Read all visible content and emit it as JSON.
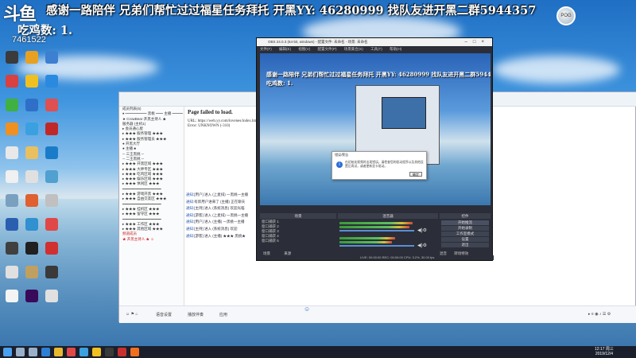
{
  "overlay": {
    "logo": "斗鱼",
    "banner": "感谢一路陪伴  兄弟们帮忙过过福星任务拜托  开黑YY: 46280999  找队友进开黑二群5944357",
    "room_id": "7461522",
    "chicken_count": "吃鸡数: 1."
  },
  "desktop_icons": [
    {
      "label": "",
      "color": "#3b3b3b"
    },
    {
      "label": "",
      "color": "#e8a020"
    },
    {
      "label": "",
      "color": "#3d7fd0"
    },
    {
      "label": "",
      "color": "#d94040"
    },
    {
      "label": "",
      "color": "#f0c020"
    },
    {
      "label": "",
      "color": "#2a8ae0"
    },
    {
      "label": "",
      "color": "#40b040"
    },
    {
      "label": "",
      "color": "#2f6fc8"
    },
    {
      "label": "",
      "color": "#e05050"
    },
    {
      "label": "",
      "color": "#f09020"
    },
    {
      "label": "",
      "color": "#3aa0e0"
    },
    {
      "label": "",
      "color": "#c02828"
    },
    {
      "label": "",
      "color": "#e8e8e8"
    },
    {
      "label": "",
      "color": "#e8c060"
    },
    {
      "label": "",
      "color": "#1a7cc8"
    },
    {
      "label": "",
      "color": "#f0f0f0"
    },
    {
      "label": "",
      "color": "#e0e0e0"
    },
    {
      "label": "",
      "color": "#50a0d0"
    },
    {
      "label": "",
      "color": "#7aa0c0"
    },
    {
      "label": "",
      "color": "#e06030"
    },
    {
      "label": "",
      "color": "#c0c0c0"
    },
    {
      "label": "",
      "color": "#2a5fb0"
    },
    {
      "label": "",
      "color": "#3090d0"
    },
    {
      "label": "",
      "color": "#e04848"
    },
    {
      "label": "",
      "color": "#404040"
    },
    {
      "label": "",
      "color": "#202020"
    },
    {
      "label": "",
      "color": "#d03030"
    },
    {
      "label": "",
      "color": "#e0e0e0"
    },
    {
      "label": "",
      "color": "#c0a060"
    },
    {
      "label": "",
      "color": "#3a3a3a"
    },
    {
      "label": "",
      "color": "#f4f4f4"
    },
    {
      "label": "",
      "color": "#3a0a5a"
    },
    {
      "label": "",
      "color": "#e0e0e0"
    }
  ],
  "chat_window": {
    "title": "",
    "page_failed": "Page failed to load.",
    "url_line": "URL: https://web.yy.com/lovenes/index.html",
    "error_line": "Error: UNKNOWN (-310)",
    "tree": [
      {
        "text": "成员列表(5)",
        "red": false
      },
      {
        "text": "♦ ━━━━━━ 黑桃 ━━ 主播 ━━━",
        "red": false
      },
      {
        "text": "  ★ CrowBear·开黑主持人 ★",
        "red": false
      },
      {
        "text": "服务器 (主机1)",
        "red": false
      },
      {
        "text": "  ▸ 会员通心屋",
        "red": false
      },
      {
        "text": "  ▸ ★★★ 服务管理 ★★★",
        "red": false
      },
      {
        "text": "  ▸ ★★★ 服务管理员 ★★★",
        "red": false
      },
      {
        "text": "     ● 开黑大厅",
        "red": false
      },
      {
        "text": "     ● 主播 ♣",
        "red": false
      },
      {
        "text": "     ─ 三王黑桃 ─",
        "red": false
      },
      {
        "text": "     ─ 二王黑桃 ─",
        "red": false
      },
      {
        "text": "▸ ★★★ 开黑区域 ★★★",
        "red": false
      },
      {
        "text": "▸ ★★★ 大神专区 ★★★",
        "red": false
      },
      {
        "text": "▸ ★★★ 吃鸡区域 ★★★",
        "red": false
      },
      {
        "text": "▸ ★★★ 娱乐区域 ★★★",
        "red": false
      },
      {
        "text": "▸ ★★★ 休闲区 ★★★",
        "red": false
      },
      {
        "text": "━━━━━━━━━━━━━━━━━━",
        "red": false
      },
      {
        "text": "▸ ★★★ 游戏开黑 ★★★",
        "red": false
      },
      {
        "text": "▸ ★★★ 自由交友区 ★★★",
        "red": false
      },
      {
        "text": "━━━━━━━━━━━━━━━━━━",
        "red": false
      },
      {
        "text": "▸ ★★★ 挂机区 ★★★",
        "red": false
      },
      {
        "text": "▸ ★★★ 留守区 ★★★",
        "red": false
      },
      {
        "text": "━━━━━━━━━━━━━━━━━━",
        "red": false
      },
      {
        "text": "▸ ★★★ 工作区 ★★★",
        "red": false
      },
      {
        "text": "▸ ★★★ 其他区域 ★★★",
        "red": false
      },
      {
        "text": "频道成员",
        "red": true
      },
      {
        "text": "  ★ 开黑主持人 ★ ☺",
        "red": true
      }
    ],
    "messages": [
      {
        "who": "通知:",
        "text": "[用户] 进入 (上麦排) 一黑桃一主播"
      },
      {
        "who": "通知:",
        "text": "有新用户进来了 (主播) 正在聊天"
      },
      {
        "who": "通知:",
        "text": "[主持] 进入 (系统消息) 欢迎光临"
      },
      {
        "who": "通知:",
        "text": "[游客] 进入 (上麦排) 一黑桃一主播"
      },
      {
        "who": "通知:",
        "text": "[用户] 进入 (主播) 一黑桃一主播"
      },
      {
        "who": "通知:",
        "text": "[主持] 进入 (系统消息) 欢迎"
      },
      {
        "who": "通知:",
        "text": "[游客] 进入 (主播) ★★★ 黑桃★"
      }
    ],
    "bottom_items": [
      "语音设置",
      "播放伴奏",
      "应用"
    ],
    "bottom_right": "▸ ≡ ◉ ♪ ☰ ⚙"
  },
  "obs": {
    "title": "OBS 24.0.3 (64-bit, windows) - 配置文件: 未命名 - 场景: 未命名",
    "menu": "文件(F) 编辑(E) 视图(V) 配置文件(P) 场景集合(S) 工具(T) 帮助(H)",
    "preview_banner": "感谢一路陪伴  兄弟们帮忙过过福星任务拜托  开黑YY: 46280999  找队友进开黑二群5944357",
    "preview_chicken": "吃鸡数: 1.",
    "dialog_title": "错误/警告",
    "dialog_message": "在初始化视频时出现错误。请检查您的驱动程序以及其他设置后再试，或者更新显卡驱动。",
    "dialog_ok": "确定",
    "docks": {
      "scenes": "场景",
      "mixer": "混音器",
      "controls": "控件"
    },
    "sources": [
      "窗口捕获 1",
      "窗口捕获 2",
      "窗口捕获 3",
      "窗口捕获 4",
      "窗口捕获 5"
    ],
    "scene_btns": [
      "场景",
      "来源"
    ],
    "controls": [
      "开始推流",
      "开始录制",
      "工作室模式",
      "设置",
      "退出"
    ],
    "bottom_tabs": [
      "混音",
      "转场特效"
    ],
    "status": "LIVE: 00:00:00   REC: 00:00:00   CPU: 3.2%, 30.00 fps"
  },
  "taskbar": {
    "time": "12:17 周三",
    "date": "2019/12/4",
    "icons": [
      {
        "name": "start-icon",
        "color": "#4aa0f0"
      },
      {
        "name": "search-icon",
        "color": "#9ab0c8"
      },
      {
        "name": "task-view-icon",
        "color": "#9ab0c8"
      },
      {
        "name": "edge-icon",
        "color": "#2d7fd6"
      },
      {
        "name": "explorer-icon",
        "color": "#e8b830"
      },
      {
        "name": "chrome-icon",
        "color": "#e04848"
      },
      {
        "name": "qq-icon",
        "color": "#3aa0e0"
      },
      {
        "name": "yy-icon",
        "color": "#f0c020"
      },
      {
        "name": "obs-icon",
        "color": "#3a3a3a"
      },
      {
        "name": "game-icon",
        "color": "#c83030"
      },
      {
        "name": "douyu-icon",
        "color": "#f07020"
      }
    ]
  }
}
